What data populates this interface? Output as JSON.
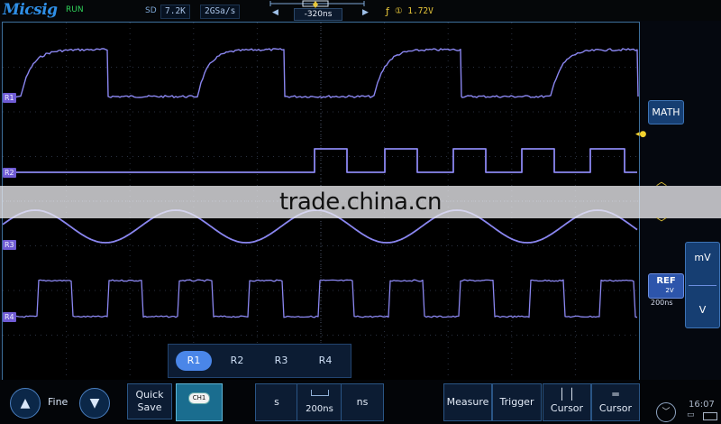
{
  "header": {
    "logo": "Micsig",
    "run_state": "RUN",
    "sd_label": "SD",
    "memory_depth": "7.2K",
    "sample_rate": "2GSa/s",
    "time_offset": "-320ns",
    "trigger_channel": "①",
    "trigger_level": "1.72V"
  },
  "channels": [
    {
      "label": "R1",
      "color": "#8f8cf0"
    },
    {
      "label": "R2",
      "color": "#7a78ea"
    },
    {
      "label": "R3",
      "color": "#8e8bea"
    },
    {
      "label": "R4",
      "color": "#8581ec"
    }
  ],
  "watermark": "trade.china.cn",
  "right_panel": {
    "math_label": "MATH",
    "ref_label": "REF",
    "ref_scale": "2V",
    "ref_timebase": "200ns",
    "unit_top": "mV",
    "unit_bottom": "V"
  },
  "ref_tabs": [
    "R1",
    "R2",
    "R3",
    "R4"
  ],
  "ref_tab_active": "R1",
  "bottom": {
    "fine_label": "Fine",
    "quick_save_line1": "Quick",
    "quick_save_line2": "Save",
    "ch1_label": "CH1",
    "unit_s": "s",
    "timebase_value": "200ns",
    "unit_ns": "ns",
    "measure_label": "Measure",
    "trigger_label": "Trigger",
    "cursor_v_label": "Cursor",
    "cursor_h_label": "Cursor",
    "clock": "16:07"
  },
  "colors": {
    "accent": "#3d73b5",
    "trace": "#8a86f0",
    "trigger": "#e8c73a",
    "run": "#2fd35a"
  }
}
